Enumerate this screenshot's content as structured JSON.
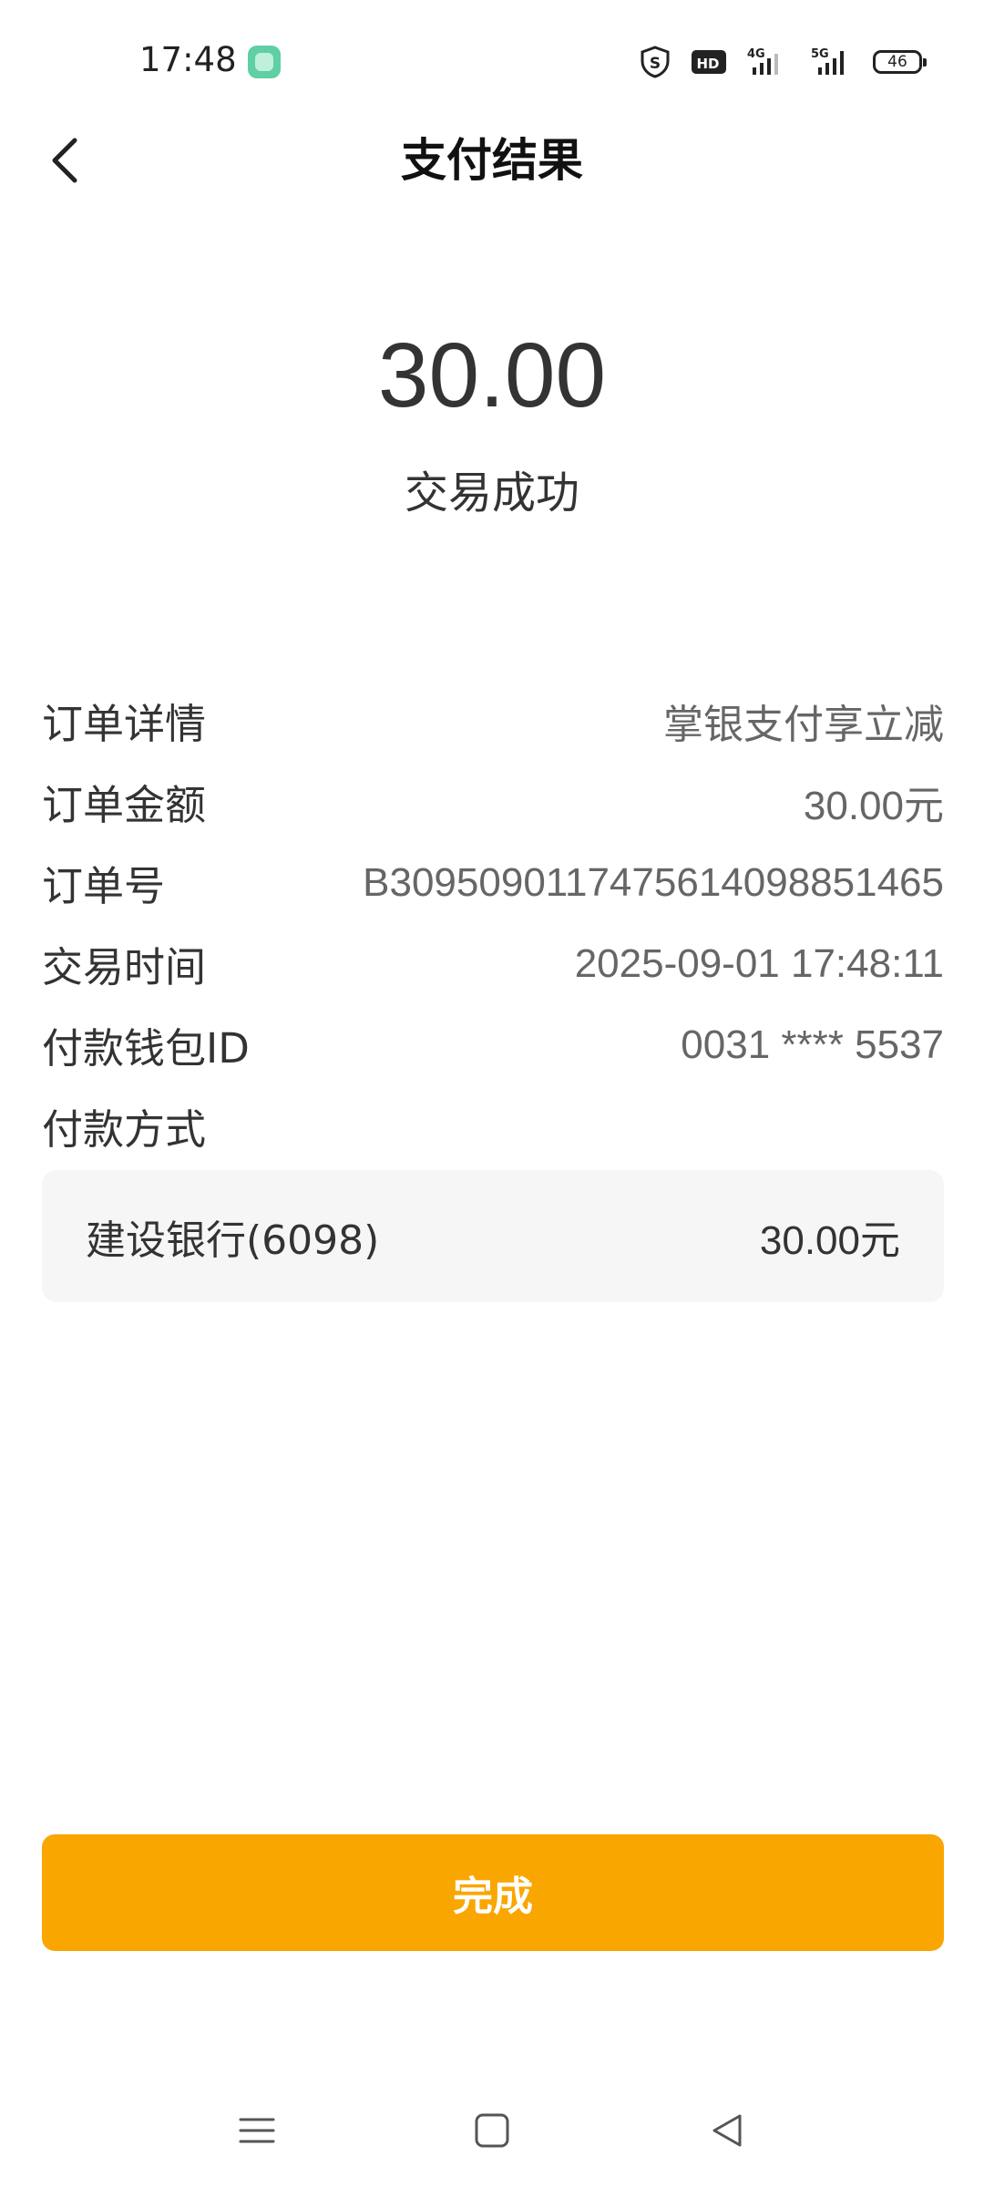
{
  "status_bar": {
    "time": "17:48",
    "hd_label": "HD",
    "net_4g": "4G",
    "net_5g": "5G",
    "battery": "46",
    "icons": [
      "app-notification-icon",
      "shield-s-icon",
      "hd-icon",
      "signal-4g-icon",
      "signal-5g-icon",
      "battery-icon"
    ]
  },
  "header": {
    "title": "支付结果"
  },
  "result": {
    "amount": "30.00",
    "status": "交易成功"
  },
  "details": [
    {
      "label": "订单详情",
      "value": "掌银支付享立减"
    },
    {
      "label": "订单金额",
      "value": "30.00元"
    },
    {
      "label": "订单号",
      "value": "B3095090117475614098851465"
    },
    {
      "label": "交易时间",
      "value": "2025-09-01 17:48:11"
    },
    {
      "label": "付款钱包ID",
      "value": "0031 **** 5537"
    },
    {
      "label": "付款方式",
      "value": ""
    }
  ],
  "payment_method": {
    "bank": "建设银行(6098)",
    "amount": "30.00元"
  },
  "actions": {
    "done_label": "完成"
  },
  "colors": {
    "accent": "#faa600",
    "card_background": "#f6f6f6",
    "app_icon": "#5fcfa4"
  }
}
